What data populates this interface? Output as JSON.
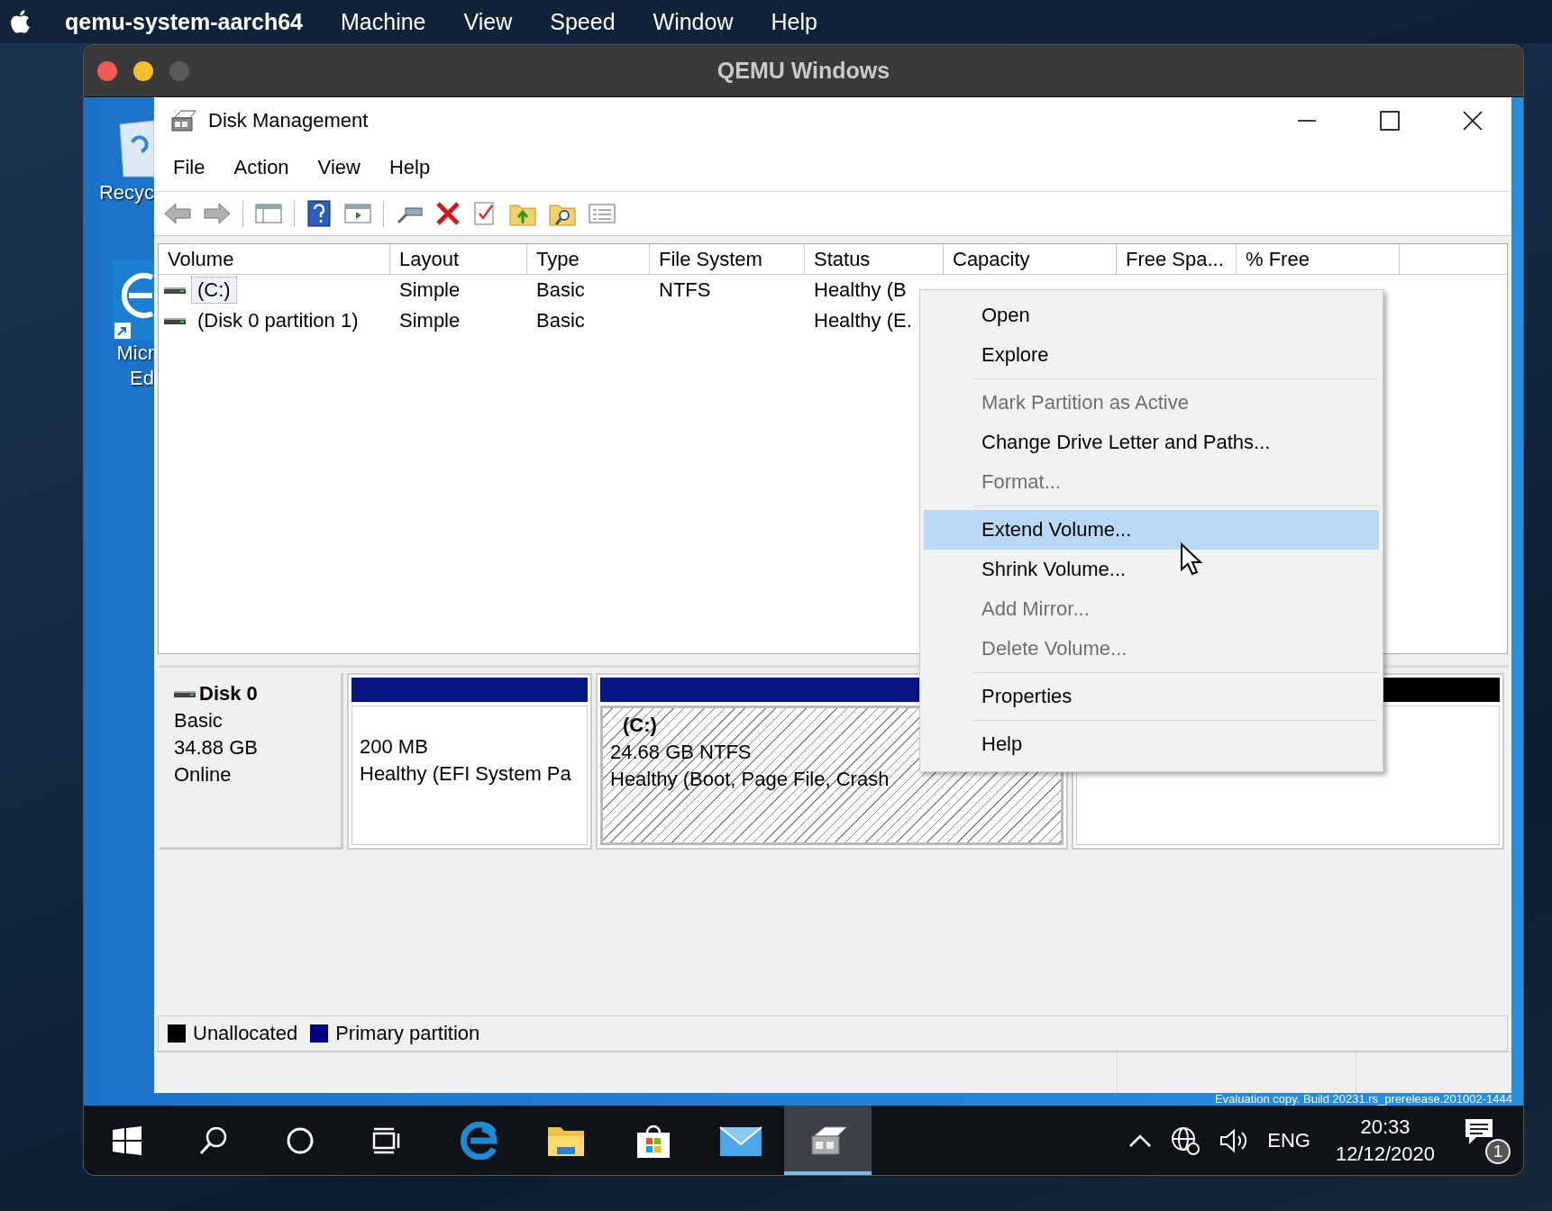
{
  "menubar": {
    "app": "qemu-system-aarch64",
    "items": [
      "Machine",
      "View",
      "Speed",
      "Window",
      "Help"
    ]
  },
  "qemu_window": {
    "title": "QEMU Windows"
  },
  "desktop_icons": [
    {
      "kind": "recycle_bin",
      "label_lines": [
        "Recyc"
      ]
    },
    {
      "kind": "browser",
      "label_lines": [
        "Micr",
        "Ed"
      ]
    }
  ],
  "dm_window": {
    "title": "Disk Management",
    "menu": [
      "File",
      "Action",
      "View",
      "Help"
    ]
  },
  "volume_table": {
    "columns": [
      "Volume",
      "Layout",
      "Type",
      "File System",
      "Status",
      "Capacity",
      "Free Spa...",
      "% Free"
    ],
    "rows": [
      {
        "volume": "(C:)",
        "layout": "Simple",
        "type": "Basic",
        "file_system": "NTFS",
        "status": "Healthy (B",
        "selected": true
      },
      {
        "volume": "(Disk 0 partition 1)",
        "layout": "Simple",
        "type": "Basic",
        "status": "Healthy (E.",
        "selected": false
      }
    ]
  },
  "disk": {
    "name": "Disk 0",
    "type": "Basic",
    "size": "34.88 GB",
    "state": "Online",
    "partitions": [
      {
        "kind": "primary",
        "selected": false,
        "lines": [
          "200 MB",
          "Healthy (EFI System Pa"
        ]
      },
      {
        "kind": "primary",
        "selected": true,
        "name": "(C:)",
        "lines": [
          "24.68 GB NTFS",
          "Healthy (Boot, Page File, Crash"
        ]
      },
      {
        "kind": "unallocated",
        "selected": false
      }
    ]
  },
  "legend": [
    {
      "label": "Unallocated",
      "color": "#000000"
    },
    {
      "label": "Primary partition",
      "color": "#000080"
    }
  ],
  "context_menu": {
    "items": [
      {
        "kind": "item",
        "label": "Open",
        "disabled": false,
        "selected": false
      },
      {
        "kind": "item",
        "label": "Explore",
        "disabled": false,
        "selected": false
      },
      {
        "kind": "separator"
      },
      {
        "kind": "item",
        "label": "Mark Partition as Active",
        "disabled": true,
        "selected": false
      },
      {
        "kind": "item",
        "label": "Change Drive Letter and Paths...",
        "disabled": false,
        "selected": false
      },
      {
        "kind": "item",
        "label": "Format...",
        "disabled": true,
        "selected": false
      },
      {
        "kind": "separator"
      },
      {
        "kind": "item",
        "label": "Extend Volume...",
        "disabled": false,
        "selected": true
      },
      {
        "kind": "item",
        "label": "Shrink Volume...",
        "disabled": false,
        "selected": false
      },
      {
        "kind": "item",
        "label": "Add Mirror...",
        "disabled": true,
        "selected": false
      },
      {
        "kind": "item",
        "label": "Delete Volume...",
        "disabled": true,
        "selected": false
      },
      {
        "kind": "separator"
      },
      {
        "kind": "item",
        "label": "Properties",
        "disabled": false,
        "selected": false
      },
      {
        "kind": "separator"
      },
      {
        "kind": "item",
        "label": "Help",
        "disabled": false,
        "selected": false
      }
    ]
  },
  "desktop_notice": "Evaluation copy. Build 20231.rs_prerelease.201002-1444",
  "taskbar": {
    "apps": [
      {
        "kind": "edge",
        "selected": false
      },
      {
        "kind": "explorer",
        "selected": false
      },
      {
        "kind": "store",
        "selected": false
      },
      {
        "kind": "mail",
        "selected": false
      },
      {
        "kind": "disk_management",
        "selected": true
      }
    ],
    "language": "ENG",
    "time": "20:33",
    "date": "12/12/2020",
    "notification_count": "1"
  }
}
